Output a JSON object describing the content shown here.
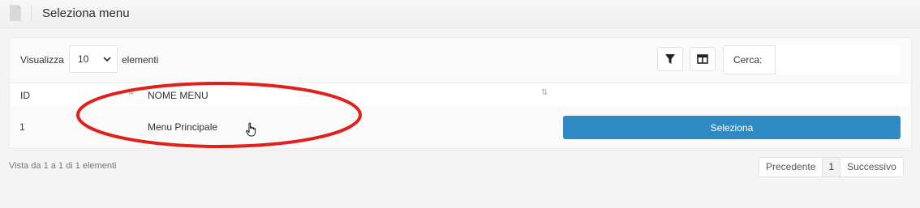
{
  "header": {
    "title": "Seleziona menu",
    "icon": "document-icon"
  },
  "toolbar": {
    "show_label": "Visualizza",
    "page_size": "10",
    "elements_label": "elementi",
    "filter_icon": "filter-icon",
    "columns_icon": "columns-icon",
    "search_label": "Cerca:",
    "search_value": ""
  },
  "table": {
    "columns": [
      "ID",
      "NOME MENU",
      ""
    ],
    "rows": [
      {
        "id": "1",
        "name": "Menu Principale",
        "action": "Seleziona"
      }
    ]
  },
  "footer": {
    "info": "Vista da 1 a 1 di 1 elementi",
    "prev": "Precedente",
    "page": "1",
    "next": "Successivo"
  },
  "colors": {
    "primary_button": "#2f8ac4",
    "annotation": "#e0201b"
  }
}
